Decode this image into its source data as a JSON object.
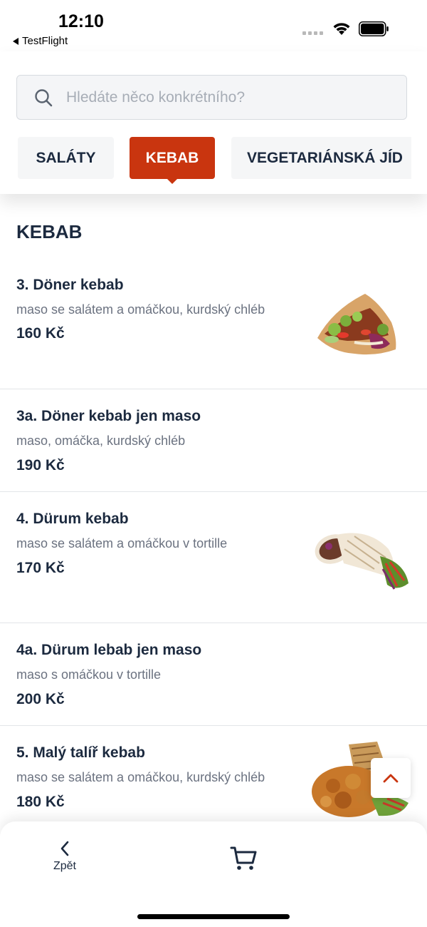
{
  "status_bar": {
    "time": "12:10",
    "back_app": "TestFlight"
  },
  "search": {
    "placeholder": "Hledáte něco konkrétního?",
    "value": ""
  },
  "tabs": [
    {
      "label": "SALÁTY",
      "active": false
    },
    {
      "label": "KEBAB",
      "active": true
    },
    {
      "label": "VEGETARIÁNSKÁ JÍD",
      "active": false
    }
  ],
  "section": {
    "title": "KEBAB"
  },
  "items": [
    {
      "name": "3. Döner kebab",
      "description": "maso se salátem a omáčkou, kurdský chléb",
      "price": "160 Kč",
      "image": "doner-kebab-photo"
    },
    {
      "name": "3a. Döner kebab jen maso",
      "description": "maso, omáčka, kurdský chléb",
      "price": "190 Kč",
      "image": null
    },
    {
      "name": "4. Dürum kebab",
      "description": "maso se salátem a omáčkou v tortille",
      "price": "170 Kč",
      "image": "durum-kebab-photo"
    },
    {
      "name": "4a. Dürum lebab jen maso",
      "description": "maso s omáčkou v tortille",
      "price": "200 Kč",
      "image": null
    },
    {
      "name": "5. Malý talíř kebab",
      "description": "maso se salátem a omáčkou, kurdský chléb",
      "price": "180 Kč",
      "image": "kebab-plate-photo"
    }
  ],
  "bottom_bar": {
    "back_label": "Zpět",
    "back_icon": "chevron-left-icon",
    "cart_icon": "cart-icon"
  },
  "colors": {
    "accent": "#c9350f",
    "text": "#1c2a3f",
    "muted": "#6b7280"
  }
}
